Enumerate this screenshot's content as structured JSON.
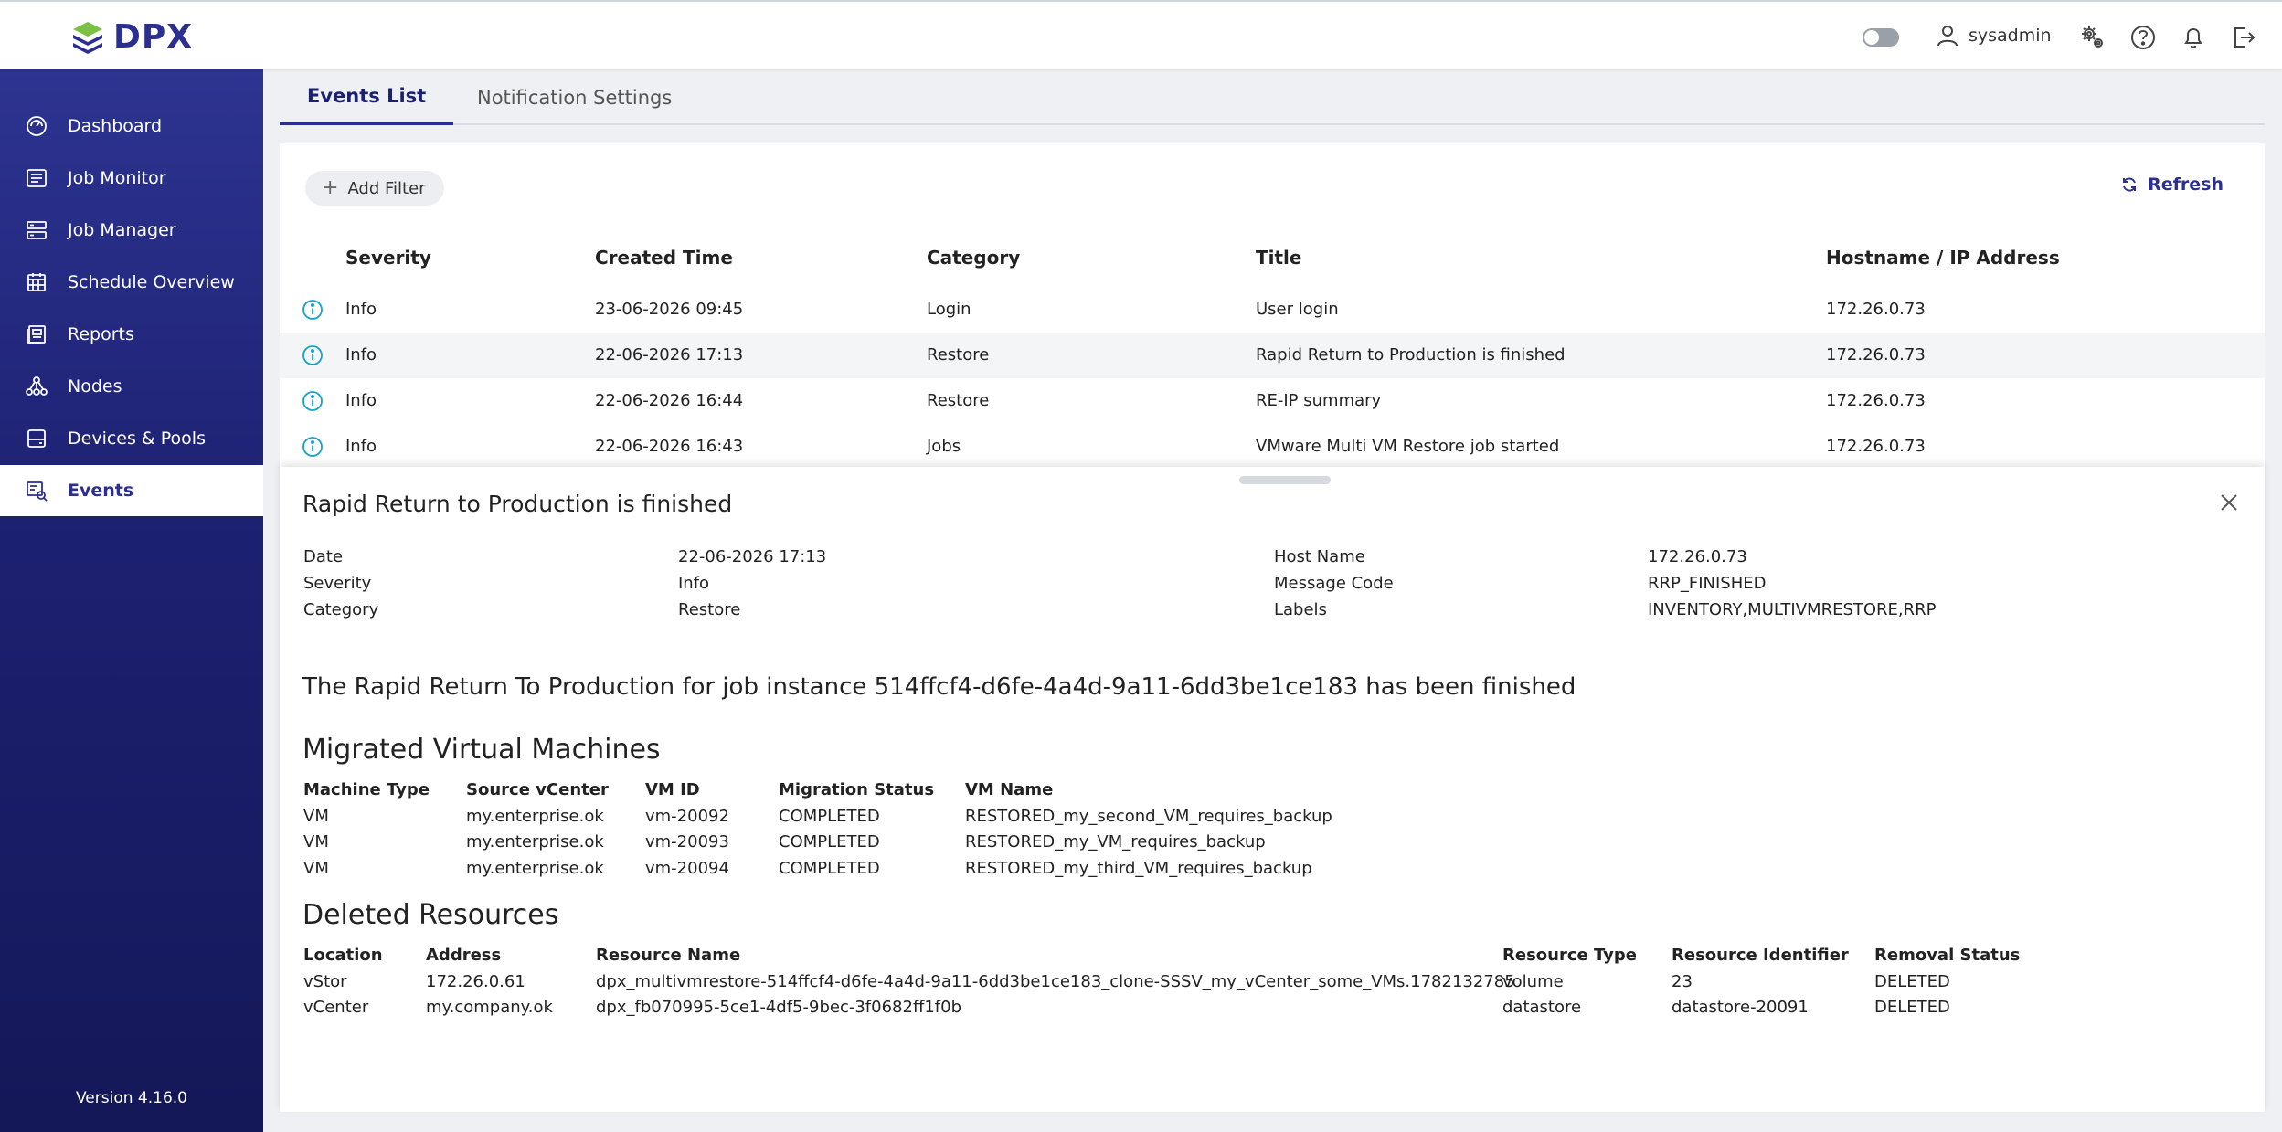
{
  "brand": {
    "name": "DPX"
  },
  "header": {
    "username": "sysadmin"
  },
  "sidebar": {
    "items": [
      {
        "label": "Dashboard",
        "icon": "dashboard-icon"
      },
      {
        "label": "Job Monitor",
        "icon": "job-monitor-icon"
      },
      {
        "label": "Job Manager",
        "icon": "job-manager-icon"
      },
      {
        "label": "Schedule Overview",
        "icon": "calendar-icon"
      },
      {
        "label": "Reports",
        "icon": "reports-icon"
      },
      {
        "label": "Nodes",
        "icon": "nodes-icon"
      },
      {
        "label": "Devices & Pools",
        "icon": "devices-icon"
      },
      {
        "label": "Events",
        "icon": "events-icon"
      }
    ],
    "version": "Version 4.16.0"
  },
  "tabs": [
    {
      "label": "Events List"
    },
    {
      "label": "Notification Settings"
    }
  ],
  "toolbar": {
    "add_filter": "Add Filter",
    "refresh": "Refresh"
  },
  "events": {
    "columns": [
      "Severity",
      "Created Time",
      "Category",
      "Title",
      "Hostname / IP Address"
    ],
    "rows": [
      {
        "severity": "Info",
        "time": "23-06-2026 09:45",
        "category": "Login",
        "title": "User login",
        "host": "172.26.0.73"
      },
      {
        "severity": "Info",
        "time": "22-06-2026 17:13",
        "category": "Restore",
        "title": "Rapid Return to Production is finished",
        "host": "172.26.0.73"
      },
      {
        "severity": "Info",
        "time": "22-06-2026 16:44",
        "category": "Restore",
        "title": "RE-IP summary",
        "host": "172.26.0.73"
      },
      {
        "severity": "Info",
        "time": "22-06-2026 16:43",
        "category": "Jobs",
        "title": "VMware Multi VM Restore job started",
        "host": "172.26.0.73"
      }
    ]
  },
  "detail": {
    "title": "Rapid Return to Production is finished",
    "fields_left": [
      {
        "label": "Date",
        "value": "22-06-2026 17:13"
      },
      {
        "label": "Severity",
        "value": "Info"
      },
      {
        "label": "Category",
        "value": "Restore"
      }
    ],
    "fields_right": [
      {
        "label": "Host Name",
        "value": "172.26.0.73"
      },
      {
        "label": "Message Code",
        "value": "RRP_FINISHED"
      },
      {
        "label": "Labels",
        "value": "INVENTORY,MULTIVMRESTORE,RRP"
      }
    ],
    "message": "The Rapid Return To Production for job instance 514ffcf4-d6fe-4a4d-9a11-6dd3be1ce183 has been finished",
    "migrated": {
      "heading": "Migrated Virtual Machines",
      "columns": [
        "Machine Type",
        "Source vCenter",
        "VM ID",
        "Migration Status",
        "VM Name"
      ],
      "rows": [
        [
          "VM",
          "my.enterprise.ok",
          "vm-20092",
          "COMPLETED",
          "RESTORED_my_second_VM_requires_backup"
        ],
        [
          "VM",
          "my.enterprise.ok",
          "vm-20093",
          "COMPLETED",
          "RESTORED_my_VM_requires_backup"
        ],
        [
          "VM",
          "my.enterprise.ok",
          "vm-20094",
          "COMPLETED",
          "RESTORED_my_third_VM_requires_backup"
        ]
      ]
    },
    "deleted": {
      "heading": "Deleted Resources",
      "columns": [
        "Location",
        "Address",
        "Resource Name",
        "Resource Type",
        "Resource Identifier",
        "Removal Status"
      ],
      "rows": [
        [
          "vStor",
          "172.26.0.61",
          "dpx_multivmrestore-514ffcf4-d6fe-4a4d-9a11-6dd3be1ce183_clone-SSSV_my_vCenter_some_VMs.1782132785",
          "volume",
          "23",
          "DELETED"
        ],
        [
          "vCenter",
          "my.company.ok",
          "dpx_fb070995-5ce1-4df5-9bec-3f0682ff1f0b",
          "datastore",
          "datastore-20091",
          "DELETED"
        ]
      ]
    }
  }
}
